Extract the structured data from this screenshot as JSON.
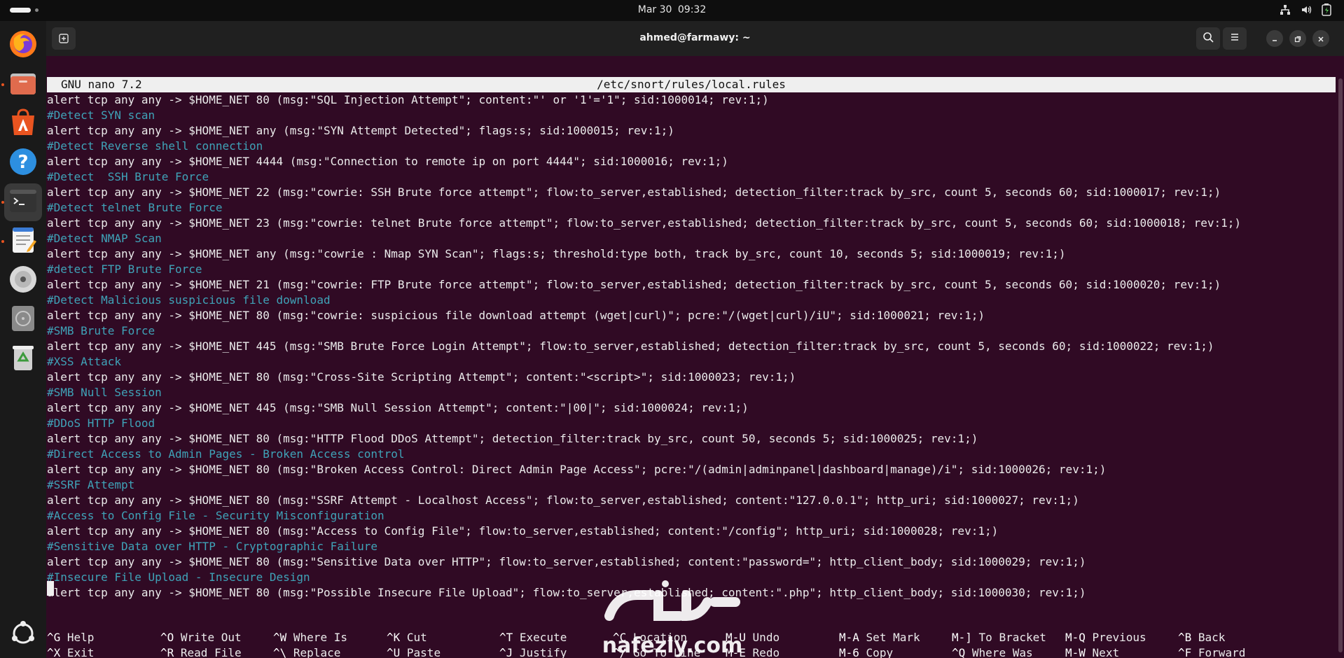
{
  "topbar": {
    "date": "Mar 30",
    "time": "09:32"
  },
  "window": {
    "title": "ahmed@farmawy: ~"
  },
  "nano": {
    "version": "GNU nano 7.2",
    "filename": "/etc/snort/rules/local.rules",
    "lines": [
      {
        "type": "rule",
        "text": "alert tcp any any -> $HOME_NET 80 (msg:\"SQL Injection Attempt\"; content:\"' or '1'='1\"; sid:1000014; rev:1;)"
      },
      {
        "type": "comment",
        "text": "#Detect SYN scan"
      },
      {
        "type": "rule",
        "text": "alert tcp any any -> $HOME_NET any (msg:\"SYN Attempt Detected\"; flags:s; sid:1000015; rev:1;)"
      },
      {
        "type": "comment",
        "text": "#Detect Reverse shell connection"
      },
      {
        "type": "rule",
        "text": "alert tcp any any -> $HOME_NET 4444 (msg:\"Connection to remote ip on port 4444\"; sid:1000016; rev:1;)"
      },
      {
        "type": "comment",
        "text": "#Detect  SSH Brute Force"
      },
      {
        "type": "rule",
        "text": "alert tcp any any -> $HOME_NET 22 (msg:\"cowrie: SSH Brute force attempt\"; flow:to_server,established; detection_filter:track by_src, count 5, seconds 60; sid:1000017; rev:1;)"
      },
      {
        "type": "comment",
        "text": "#Detect telnet Brute Force"
      },
      {
        "type": "rule",
        "text": "alert tcp any any -> $HOME_NET 23 (msg:\"cowrie: telnet Brute force attempt\"; flow:to_server,established; detection_filter:track by_src, count 5, seconds 60; sid:1000018; rev:1;)"
      },
      {
        "type": "comment",
        "text": "#Detect NMAP Scan"
      },
      {
        "type": "rule",
        "text": "alert tcp any any -> $HOME_NET any (msg:\"cowrie : Nmap SYN Scan\"; flags:s; threshold:type both, track by_src, count 10, seconds 5; sid:1000019; rev:1;)"
      },
      {
        "type": "comment",
        "text": "#detect FTP Brute Force"
      },
      {
        "type": "rule",
        "text": "alert tcp any any -> $HOME_NET 21 (msg:\"cowrie: FTP Brute force attempt\"; flow:to_server,established; detection_filter:track by_src, count 5, seconds 60; sid:1000020; rev:1;)"
      },
      {
        "type": "comment",
        "text": "#Detect Malicious suspicious file download"
      },
      {
        "type": "rule",
        "text": "alert tcp any any -> $HOME_NET 80 (msg:\"cowrie: suspicious file download attempt (wget|curl)\"; pcre:\"/(wget|curl)/iU\"; sid:1000021; rev:1;)"
      },
      {
        "type": "comment",
        "text": "#SMB Brute Force"
      },
      {
        "type": "rule",
        "text": "alert tcp any any -> $HOME_NET 445 (msg:\"SMB Brute Force Login Attempt\"; flow:to_server,established; detection_filter:track by_src, count 5, seconds 60; sid:1000022; rev:1;)"
      },
      {
        "type": "comment",
        "text": "#XSS Attack"
      },
      {
        "type": "rule",
        "text": "alert tcp any any -> $HOME_NET 80 (msg:\"Cross-Site Scripting Attempt\"; content:\"<script>\"; sid:1000023; rev:1;)"
      },
      {
        "type": "comment",
        "text": "#SMB Null Session"
      },
      {
        "type": "rule",
        "text": "alert tcp any any -> $HOME_NET 445 (msg:\"SMB Null Session Attempt\"; content:\"|00|\"; sid:1000024; rev:1;)"
      },
      {
        "type": "comment",
        "text": "#DDoS HTTP Flood"
      },
      {
        "type": "rule",
        "text": "alert tcp any any -> $HOME_NET 80 (msg:\"HTTP Flood DDoS Attempt\"; detection_filter:track by_src, count 50, seconds 5; sid:1000025; rev:1;)"
      },
      {
        "type": "comment",
        "text": "#Direct Access to Admin Pages - Broken Access control"
      },
      {
        "type": "rule",
        "text": "alert tcp any any -> $HOME_NET 80 (msg:\"Broken Access Control: Direct Admin Page Access\"; pcre:\"/(admin|adminpanel|dashboard|manage)/i\"; sid:1000026; rev:1;)"
      },
      {
        "type": "comment",
        "text": "#SSRF Attempt"
      },
      {
        "type": "rule",
        "text": "alert tcp any any -> $HOME_NET 80 (msg:\"SSRF Attempt - Localhost Access\"; flow:to_server,established; content:\"127.0.0.1\"; http_uri; sid:1000027; rev:1;)"
      },
      {
        "type": "comment",
        "text": "#Access to Config File - Security Misconfiguration"
      },
      {
        "type": "rule",
        "text": "alert tcp any any -> $HOME_NET 80 (msg:\"Access to Config File\"; flow:to_server,established; content:\"/config\"; http_uri; sid:1000028; rev:1;)"
      },
      {
        "type": "comment",
        "text": "#Sensitive Data over HTTP - Cryptographic Failure"
      },
      {
        "type": "rule",
        "text": "alert tcp any any -> $HOME_NET 80 (msg:\"Sensitive Data over HTTP\"; flow:to_server,established; content:\"password=\"; http_client_body; sid:1000029; rev:1;)"
      },
      {
        "type": "comment",
        "text": "#Insecure File Upload - Insecure Design"
      },
      {
        "type": "rule",
        "text": "alert tcp any any -> $HOME_NET 80 (msg:\"Possible Insecure File Upload\"; flow:to_server,established; content:\".php\"; http_client_body; sid:1000030; rev:1;)"
      }
    ],
    "shortcuts": [
      [
        {
          "key": "^G",
          "label": "Help"
        },
        {
          "key": "^X",
          "label": "Exit"
        }
      ],
      [
        {
          "key": "^O",
          "label": "Write Out"
        },
        {
          "key": "^R",
          "label": "Read File"
        }
      ],
      [
        {
          "key": "^W",
          "label": "Where Is"
        },
        {
          "key": "^\\",
          "label": "Replace"
        }
      ],
      [
        {
          "key": "^K",
          "label": "Cut"
        },
        {
          "key": "^U",
          "label": "Paste"
        }
      ],
      [
        {
          "key": "^T",
          "label": "Execute"
        },
        {
          "key": "^J",
          "label": "Justify"
        }
      ],
      [
        {
          "key": "^C",
          "label": "Location"
        },
        {
          "key": "^/",
          "label": "Go To Line"
        }
      ],
      [
        {
          "key": "M-U",
          "label": "Undo"
        },
        {
          "key": "M-E",
          "label": "Redo"
        }
      ],
      [
        {
          "key": "M-A",
          "label": "Set Mark"
        },
        {
          "key": "M-6",
          "label": "Copy"
        }
      ],
      [
        {
          "key": "M-]",
          "label": "To Bracket"
        },
        {
          "key": "^Q",
          "label": "Where Was"
        }
      ],
      [
        {
          "key": "M-Q",
          "label": "Previous"
        },
        {
          "key": "M-W",
          "label": "Next"
        }
      ],
      [
        {
          "key": "^B",
          "label": "Back"
        },
        {
          "key": "^F",
          "label": "Forward"
        }
      ]
    ]
  },
  "watermark": {
    "text": "nafezly.com"
  },
  "colors": {
    "terminal_bg": "#300a24",
    "comment": "#3fa3b8",
    "accent": "#e95420"
  }
}
